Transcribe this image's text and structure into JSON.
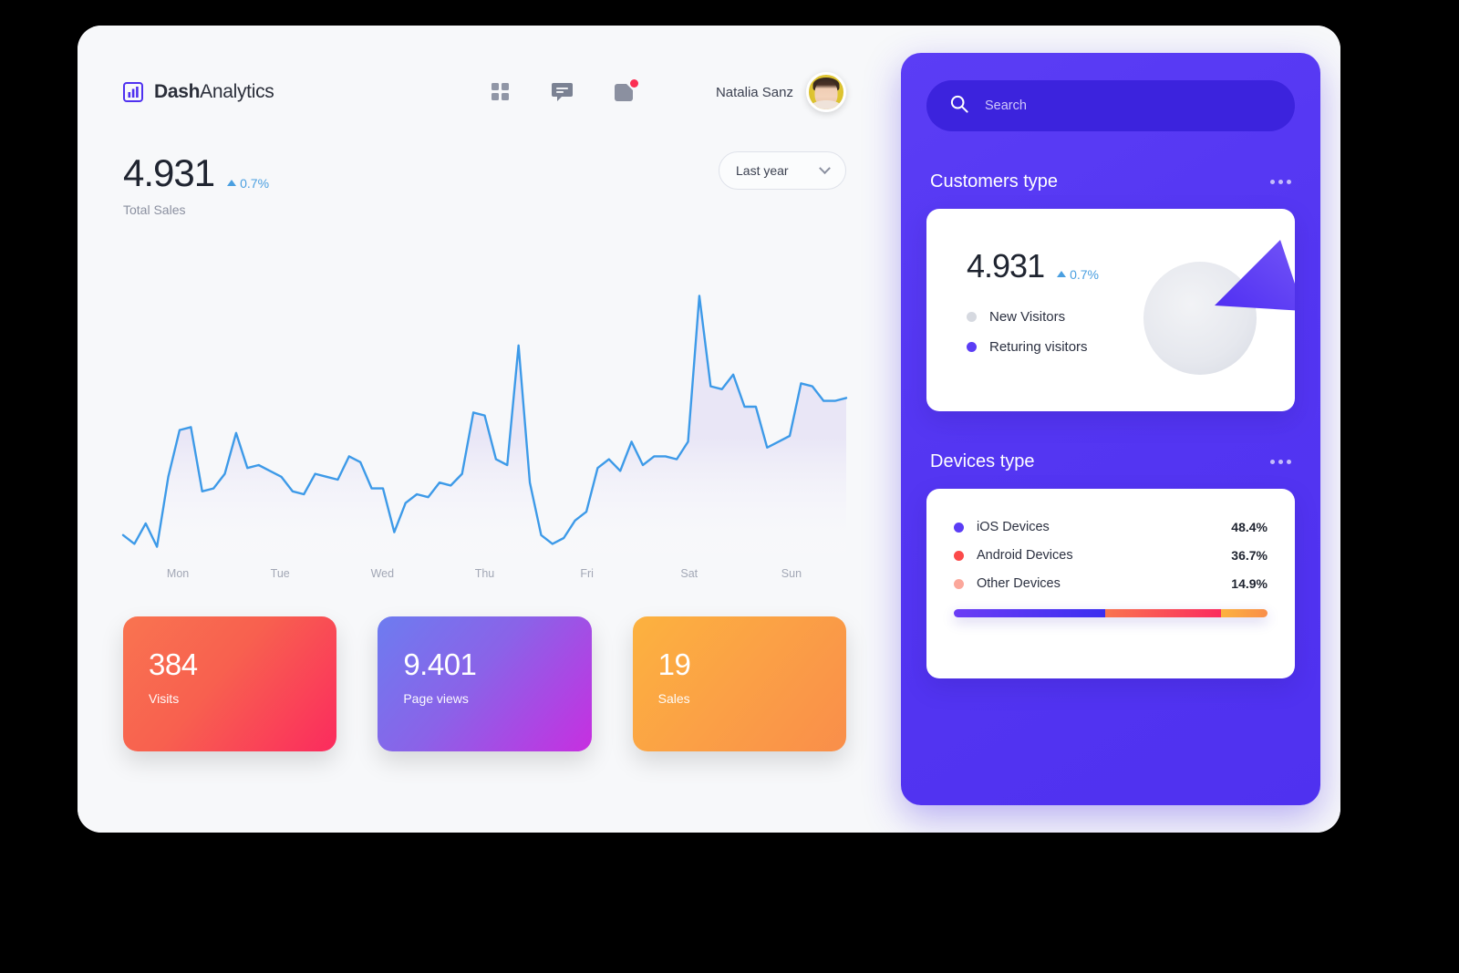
{
  "brand": {
    "name_bold": "Dash",
    "name_rest": "Analytics",
    "logo_icon": "bar-chart-icon",
    "accent": "#4f31f0"
  },
  "topbar": {
    "icons": [
      {
        "name": "grid-icon",
        "label": "Apps"
      },
      {
        "name": "chat-icon",
        "label": "Messages"
      },
      {
        "name": "notifications-icon",
        "label": "Notifications",
        "has_badge": true,
        "badge_color": "#fb2e52"
      }
    ],
    "user": {
      "name": "Natalia Sanz",
      "avatar_name": "user-avatar"
    }
  },
  "kpi": {
    "value": "4.931",
    "delta": "0.7%",
    "delta_direction": "up",
    "delta_color": "#4a9fe0",
    "label": "Total Sales"
  },
  "range_selector": {
    "value": "Last year",
    "icon": "chevron-down-icon"
  },
  "chart_data": {
    "type": "line",
    "title": "Total Sales",
    "xlabel": "",
    "ylabel": "",
    "categories": [
      "Mon",
      "Tue",
      "Wed",
      "Thu",
      "Fri",
      "Sat",
      "Sun"
    ],
    "line_color": "#3d9ae8",
    "fill": "gradient lavender to transparent",
    "grid": false,
    "legend": "none",
    "ylim": [
      0,
      100
    ],
    "values": [
      6,
      3,
      10,
      2,
      26,
      42,
      43,
      21,
      22,
      27,
      41,
      29,
      30,
      28,
      26,
      21,
      20,
      27,
      26,
      25,
      33,
      31,
      22,
      22,
      7,
      17,
      20,
      19,
      24,
      23,
      27,
      48,
      47,
      32,
      30,
      71,
      24,
      6,
      3,
      5,
      11,
      14,
      29,
      32,
      28,
      38,
      30,
      33,
      33,
      32,
      38,
      88,
      57,
      56,
      61,
      50,
      50,
      36,
      38,
      40,
      58,
      57,
      52,
      52,
      53
    ]
  },
  "stat_cards": [
    {
      "name": "visits-card",
      "value": "384",
      "label": "Visits",
      "gradient_from": "#f97450",
      "gradient_to": "#fb2b5e"
    },
    {
      "name": "page-views-card",
      "value": "9.401",
      "label": "Page views",
      "gradient_from": "#6d7cf0",
      "gradient_to": "#c72fe0"
    },
    {
      "name": "sales-card",
      "value": "19",
      "label": "Sales",
      "gradient_from": "#fcb23f",
      "gradient_to": "#f98e4a"
    }
  ],
  "search": {
    "placeholder": "Search",
    "icon": "search-icon"
  },
  "customers": {
    "section_title": "Customers type",
    "menu_icon": "more-options-icon",
    "value": "4.931",
    "delta": "0.7%",
    "delta_direction": "up",
    "legend": [
      {
        "label": "New Visitors",
        "color": "#d6d9e0"
      },
      {
        "label": "Returing visitors",
        "color": "#5b3df5"
      }
    ],
    "pie": {
      "type": "pie",
      "slices": [
        {
          "label": "New Visitors",
          "value": 83,
          "color": "#e6e8ed"
        },
        {
          "label": "Returing visitors",
          "value": 17,
          "color": "#5b3df5",
          "exploded": true
        }
      ]
    }
  },
  "devices": {
    "section_title": "Devices type",
    "menu_icon": "more-options-icon",
    "rows": [
      {
        "label": "iOS Devices",
        "pct": "48.4%",
        "value": 48.4,
        "color": "#5b3df5"
      },
      {
        "label": "Android Devices",
        "pct": "36.7%",
        "value": 36.7,
        "color": "#fb4a4a"
      },
      {
        "label": "Other Devices",
        "pct": "14.9%",
        "value": 14.9,
        "color": "#fba79b"
      }
    ]
  }
}
